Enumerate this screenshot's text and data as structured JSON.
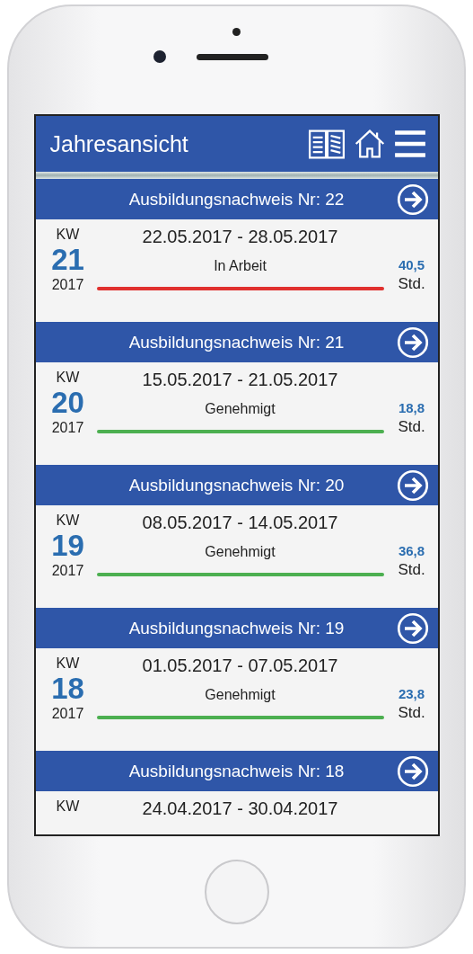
{
  "header": {
    "title": "Jahresansicht"
  },
  "reports": [
    {
      "title": "Ausbildungsnachweis Nr: 22",
      "kw_label": "KW",
      "week": "21",
      "year": "2017",
      "range": "22.05.2017 - 28.05.2017",
      "status": "In Arbeit",
      "color": "#e0302e",
      "hours": "40,5",
      "unit": "Std."
    },
    {
      "title": "Ausbildungsnachweis Nr: 21",
      "kw_label": "KW",
      "week": "20",
      "year": "2017",
      "range": "15.05.2017 - 21.05.2017",
      "status": "Genehmigt",
      "color": "#4caf50",
      "hours": "18,8",
      "unit": "Std."
    },
    {
      "title": "Ausbildungsnachweis Nr: 20",
      "kw_label": "KW",
      "week": "19",
      "year": "2017",
      "range": "08.05.2017 - 14.05.2017",
      "status": "Genehmigt",
      "color": "#4caf50",
      "hours": "36,8",
      "unit": "Std."
    },
    {
      "title": "Ausbildungsnachweis Nr: 19",
      "kw_label": "KW",
      "week": "18",
      "year": "2017",
      "range": "01.05.2017 - 07.05.2017",
      "status": "Genehmigt",
      "color": "#4caf50",
      "hours": "23,8",
      "unit": "Std."
    },
    {
      "title": "Ausbildungsnachweis Nr: 18",
      "kw_label": "KW",
      "range": "24.04.2017 - 30.04.2017"
    }
  ]
}
